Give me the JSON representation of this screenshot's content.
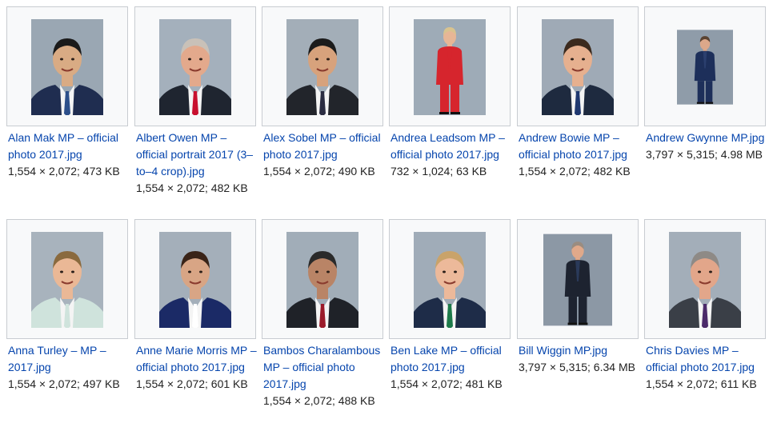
{
  "gallery": {
    "items": [
      {
        "title": "Alan Mak MP – official photo 2017.jpg",
        "meta": "1,554 × 2,072; 473 KB",
        "icon": "portrait-photo",
        "skin": "#d9ab84",
        "hair": "#1a1a1a",
        "suit": "#1f2d50",
        "tie": "#2c4f8a",
        "bg": "#9aa7b3"
      },
      {
        "title": "Albert Owen MP – official portrait 2017 (3–to–4 crop).jpg",
        "meta": "1,554 × 2,072; 482 KB",
        "icon": "portrait-photo",
        "skin": "#e3a98c",
        "hair": "#c9c1b8",
        "suit": "#1f2530",
        "tie": "#c8102e",
        "bg": "#a4b0bc"
      },
      {
        "title": "Alex Sobel MP – official photo 2017.jpg",
        "meta": "1,554 × 2,072; 490 KB",
        "icon": "portrait-photo",
        "skin": "#d7a27c",
        "hair": "#1b1b1b",
        "suit": "#22252b",
        "tie": "#2b2d42",
        "bg": "#a3aeb8"
      },
      {
        "title": "Andrea Leadsom MP – official photo 2017.jpg",
        "meta": "732 × 1,024; 63 KB",
        "icon": "portrait-photo",
        "skin": "#e7b696",
        "hair": "#d9c38f",
        "suit": "#d6252d",
        "tie": "#d6252d",
        "bg": "#9eabb7"
      },
      {
        "title": "Andrew Bowie MP – official photo 2017.jpg",
        "meta": "1,554 × 2,072; 482 KB",
        "icon": "portrait-photo",
        "skin": "#e6b08f",
        "hair": "#3b2a1e",
        "suit": "#1e2a3f",
        "tie": "#1f3870",
        "bg": "#9faab6"
      },
      {
        "title": "Andrew Gwynne MP.jpg",
        "meta": "3,797 × 5,315; 4.98 MB",
        "icon": "portrait-photo",
        "skin": "#dca88a",
        "hair": "#5a4332",
        "suit": "#1d2f5a",
        "tie": "#2b3f6e",
        "bg": "#8f9ca9"
      },
      {
        "title": "Anna Turley – MP – 2017.jpg",
        "meta": "1,554 × 2,072; 497 KB",
        "icon": "portrait-photo",
        "skin": "#eab896",
        "hair": "#8a6a3e",
        "suit": "#cfe3dc",
        "tie": "#cfe3dc",
        "bg": "#a8b3bd"
      },
      {
        "title": "Anne Marie Morris MP – official photo 2017.jpg",
        "meta": "1,554 × 2,072; 601 KB",
        "icon": "portrait-photo",
        "skin": "#d8a585",
        "hair": "#3a2418",
        "suit": "#1b2a66",
        "tie": "#ffffff",
        "bg": "#a4afba"
      },
      {
        "title": "Bambos Charalambous MP – official photo 2017.jpg",
        "meta": "1,554 × 2,072; 488 KB",
        "icon": "portrait-photo",
        "skin": "#b98466",
        "hair": "#2a2a2a",
        "suit": "#1f2228",
        "tie": "#9b1b2a",
        "bg": "#a1adb8"
      },
      {
        "title": "Ben Lake MP – official photo 2017.jpg",
        "meta": "1,554 × 2,072; 481 KB",
        "icon": "portrait-photo",
        "skin": "#ecb99a",
        "hair": "#c9a36a",
        "suit": "#1e2c48",
        "tie": "#1d7a4a",
        "bg": "#a0acb8"
      },
      {
        "title": "Bill Wiggin MP.jpg",
        "meta": "3,797 × 5,315; 6.34 MB",
        "icon": "portrait-photo",
        "skin": "#e0a98a",
        "hair": "#9a8c80",
        "suit": "#1d2330",
        "tie": "#2a3a5a",
        "bg": "#8c98a5"
      },
      {
        "title": "Chris Davies MP – official photo 2017.jpg",
        "meta": "1,554 × 2,072; 611 KB",
        "icon": "portrait-photo",
        "skin": "#e2a68a",
        "hair": "#8e8a86",
        "suit": "#3a3f47",
        "tie": "#4b2a6a",
        "bg": "#a3aeb9"
      }
    ]
  }
}
